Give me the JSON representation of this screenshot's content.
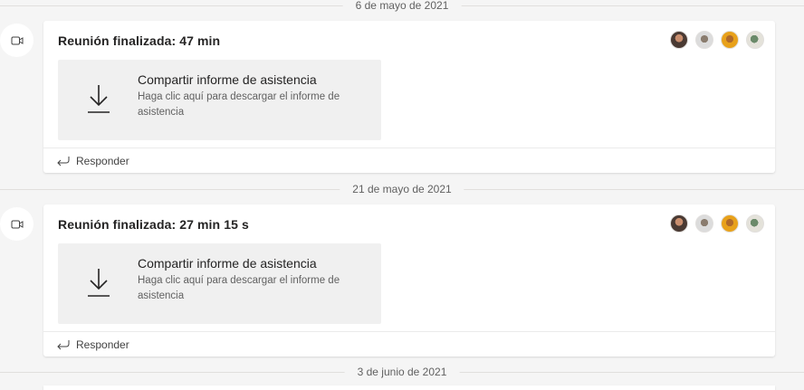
{
  "colors": {
    "background": "#f5f5f5",
    "card": "#ffffff",
    "attachment_bg": "#f0f0f0",
    "separator": "#e1dfdd",
    "text_primary": "#252424",
    "text_secondary": "#616161"
  },
  "messages": [
    {
      "date": "6 de mayo de 2021",
      "title_prefix": "Reunión finalizada:",
      "duration": "47 min",
      "participants": [
        "avatar-1",
        "avatar-2",
        "avatar-3",
        "avatar-4"
      ],
      "attachment": {
        "icon": "download-icon",
        "title": "Compartir informe de asistencia",
        "description": "Haga clic aquí para descargar el informe de asistencia"
      },
      "reply_label": "Responder"
    },
    {
      "date": "21 de mayo de 2021",
      "title_prefix": "Reunión finalizada:",
      "duration": "27 min 15 s",
      "participants": [
        "avatar-1",
        "avatar-2",
        "avatar-3",
        "avatar-4"
      ],
      "attachment": {
        "icon": "download-icon",
        "title": "Compartir informe de asistencia",
        "description": "Haga clic aquí para descargar el informe de asistencia"
      },
      "reply_label": "Responder"
    }
  ],
  "next_date": "3 de junio de 2021"
}
